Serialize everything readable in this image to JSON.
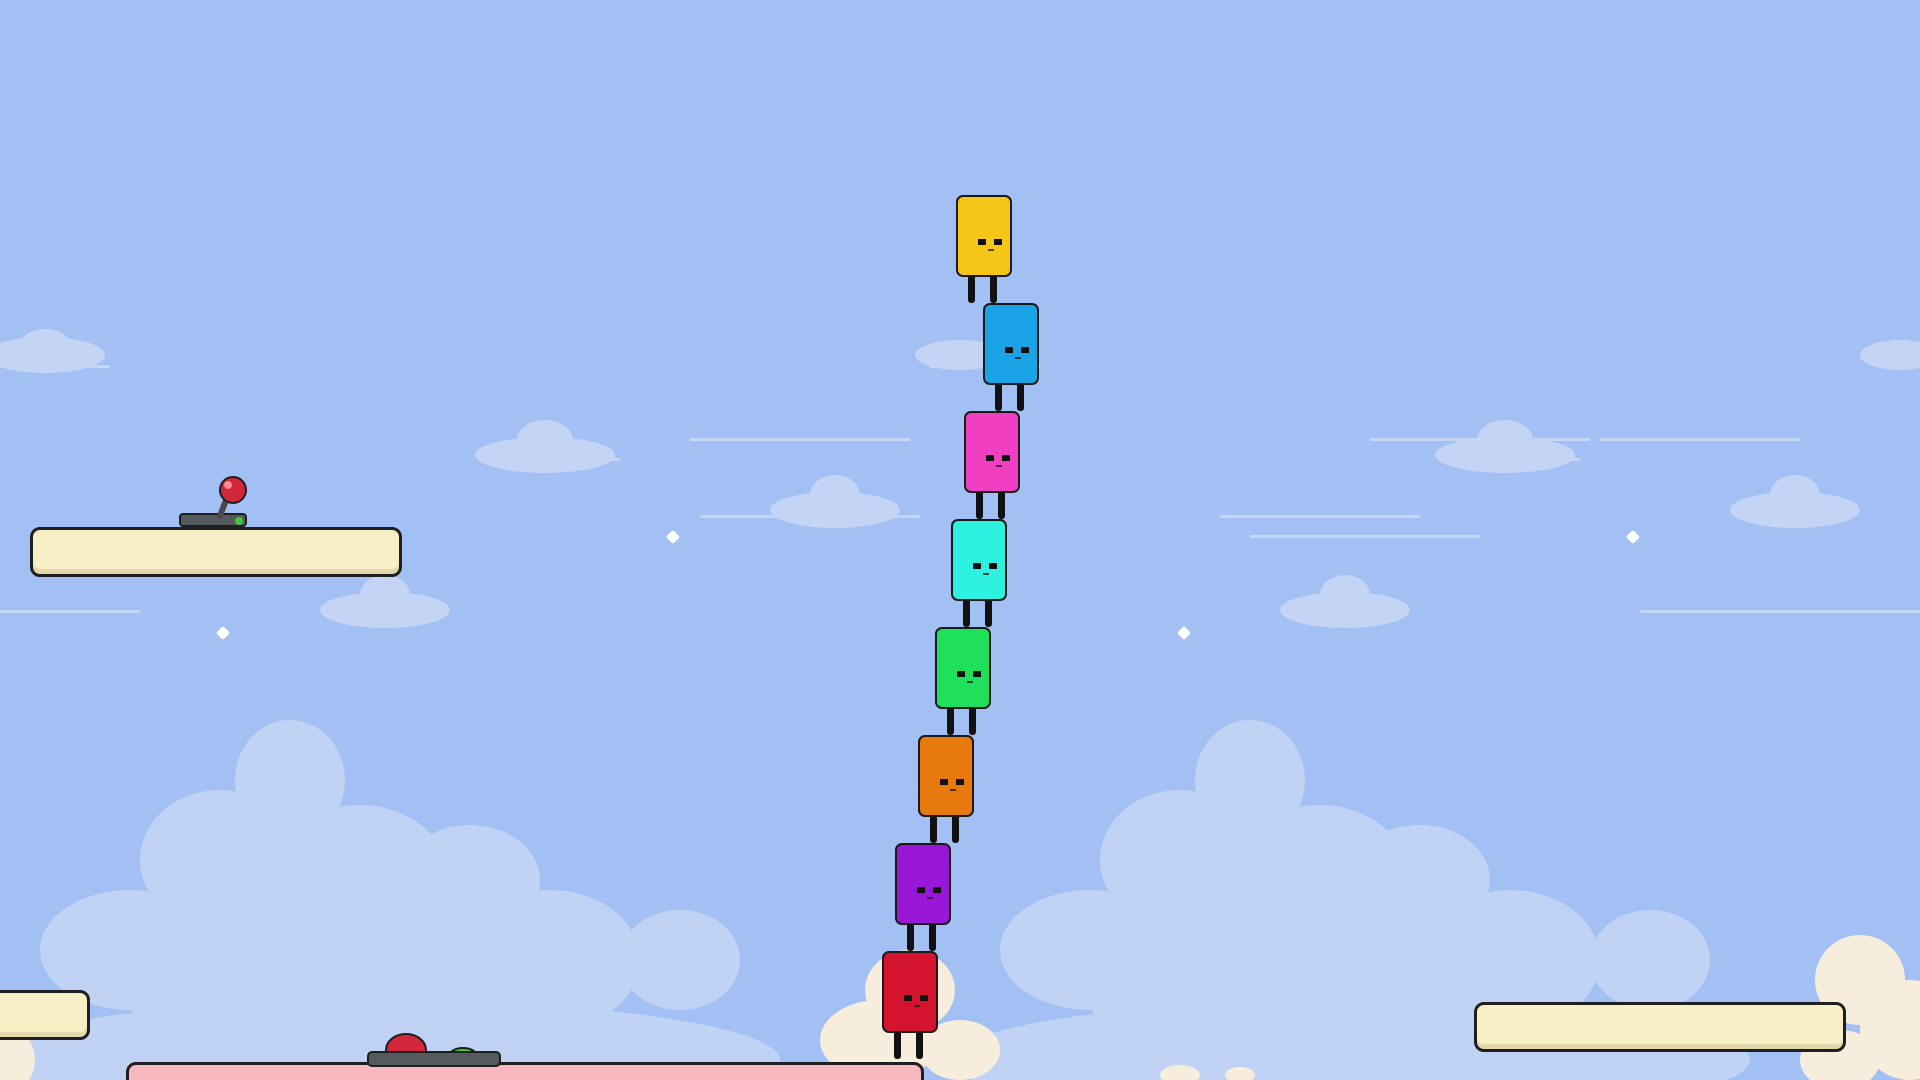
{
  "scene": {
    "title": ""
  },
  "colors": {
    "sky": "#a2c0f3",
    "platform": "#f7efc6",
    "pink_platform": "#f6b7bf",
    "outline": "#1f1f1f"
  },
  "lever": {
    "icon": "lever-icon",
    "knob_color": "#d3273b",
    "light_color": "#43c743"
  },
  "pressure_button": {
    "icon": "pressure-button-icon",
    "color": "#d3273b",
    "indicator": "#43c743"
  },
  "characters": [
    {
      "name": "yellow",
      "color": "#f5c518"
    },
    {
      "name": "blue",
      "color": "#1aa3e6"
    },
    {
      "name": "pink",
      "color": "#f03fc0"
    },
    {
      "name": "cyan",
      "color": "#2ef2e0"
    },
    {
      "name": "green",
      "color": "#1fe05a"
    },
    {
      "name": "orange",
      "color": "#e8790d"
    },
    {
      "name": "purple",
      "color": "#9a17d8"
    },
    {
      "name": "red",
      "color": "#d4132f"
    }
  ]
}
